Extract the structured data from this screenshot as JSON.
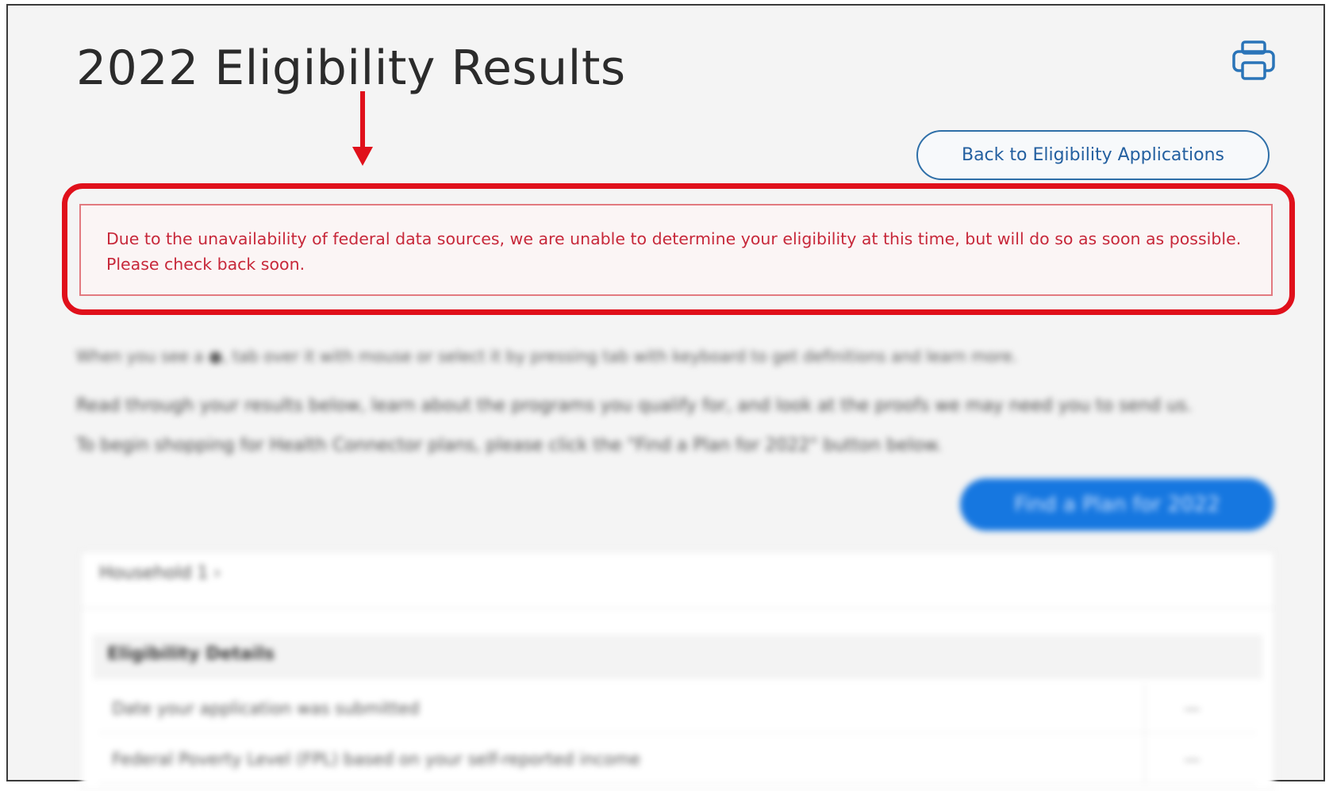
{
  "page": {
    "title": "2022 Eligibility Results",
    "print_icon": "printer-icon",
    "back_button_label": "Back to Eligibility Applications",
    "alert_message": "Due to the unavailability of federal data sources, we are unable to determine your eligibility at this time, but will do so as soon as possible. Please check back soon.",
    "annotation": {
      "arrow_color": "#e0101b",
      "highlight_color": "#e0101b"
    }
  },
  "blurred": {
    "help_line": "When you see a ●, tab over it with mouse or select it by pressing tab with keyboard to get definitions and learn more.",
    "intro_line": "Read through your results below, learn about the programs you qualify for, and look at the proofs we may need you to send us.",
    "shop_line": "To begin shopping for Health Connector plans, please click the \"Find a Plan for 2022\" button below.",
    "find_plan_button": "Find a Plan for 2022",
    "household_label": "Household 1 ›",
    "eligibility_details_heading": "Eligibility Details",
    "rows": [
      {
        "label": "Date your application was submitted",
        "value": "—"
      },
      {
        "label": "Federal Poverty Level (FPL) based on your self-reported income",
        "value": "—"
      }
    ]
  },
  "colors": {
    "accent_blue": "#2460a0",
    "alert_text": "#c7283a",
    "alert_border": "#e27a80",
    "primary_button": "#1677e0"
  }
}
